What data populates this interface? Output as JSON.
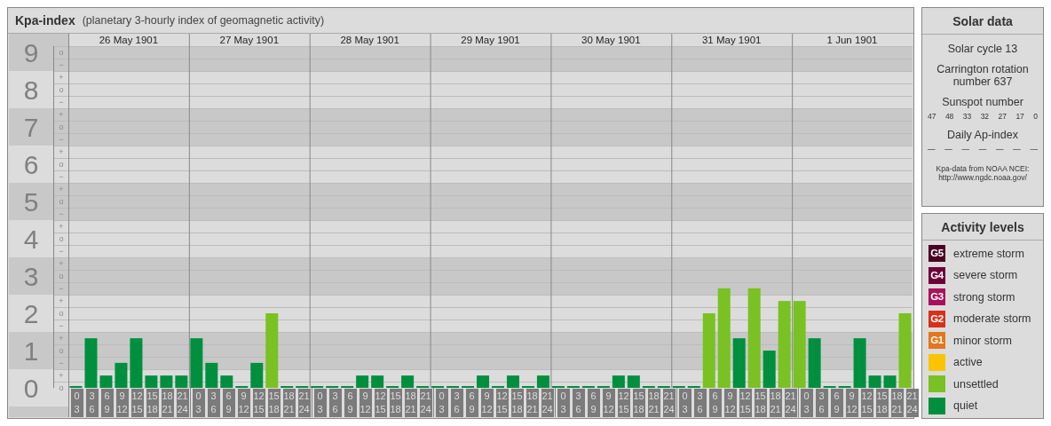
{
  "kpa_panel": {
    "title": "Kpa-index",
    "subtitle": "(planetary 3-hourly index of geomagnetic activity)",
    "days": [
      "26 May 1901",
      "27 May 1901",
      "28 May 1901",
      "29 May 1901",
      "30 May 1901",
      "31 May 1901",
      "1 Jun 1901"
    ],
    "chart_data": {
      "type": "bar",
      "ylim": [
        0,
        9.5
      ],
      "grid": true,
      "categories": [
        "0 3",
        "3 6",
        "6 9",
        "9 12",
        "12 15",
        "15 18",
        "18 21",
        "21 24",
        "0 3",
        "3 6",
        "6 9",
        "9 12",
        "12 15",
        "15 18",
        "18 21",
        "21 24",
        "0 3",
        "3 6",
        "6 9",
        "9 12",
        "12 15",
        "15 18",
        "18 21",
        "21 24",
        "0 3",
        "3 6",
        "6 9",
        "9 12",
        "12 15",
        "15 18",
        "18 21",
        "21 24",
        "0 3",
        "3 6",
        "6 9",
        "9 12",
        "12 15",
        "15 18",
        "18 21",
        "21 24",
        "0 3",
        "3 6",
        "6 9",
        "9 12",
        "12 15",
        "15 18",
        "18 21",
        "21 24",
        "0 3",
        "3 6",
        "6 9",
        "9 12",
        "12 15",
        "15 18",
        "18 21",
        "21 24"
      ],
      "series": [
        {
          "color": "#008f3e",
          "values": [
            0,
            1.33,
            0.33,
            0.67,
            1.33,
            0.33,
            0.33,
            0.33,
            1.33,
            0.67,
            0.33,
            0,
            0.67,
            null,
            0,
            0,
            0,
            0,
            0,
            0.33,
            0.33,
            0,
            0.33,
            0,
            0,
            0,
            0,
            0.33,
            0,
            0.33,
            0,
            0.33,
            0,
            0,
            0,
            0,
            0.33,
            0.33,
            0,
            0,
            0,
            0,
            null,
            null,
            1.33,
            null,
            1,
            null,
            null,
            1.33,
            0,
            0,
            1.33,
            0.33,
            0.33,
            null
          ]
        },
        {
          "color": "#7ac123",
          "values": [
            null,
            null,
            null,
            null,
            null,
            null,
            null,
            null,
            null,
            null,
            null,
            null,
            null,
            2,
            null,
            null,
            null,
            null,
            null,
            null,
            null,
            null,
            null,
            null,
            null,
            null,
            null,
            null,
            null,
            null,
            null,
            null,
            null,
            null,
            null,
            null,
            null,
            null,
            null,
            null,
            null,
            null,
            2,
            2.67,
            null,
            2.67,
            null,
            2.33,
            2.33,
            null,
            null,
            null,
            null,
            null,
            null,
            2
          ]
        }
      ],
      "yticks": [
        0,
        1,
        2,
        3,
        4,
        5,
        6,
        7,
        8,
        9
      ],
      "annotations": [
        "o",
        "+",
        "−",
        "o",
        "+",
        "−",
        "o",
        "+",
        "−",
        "o",
        "+",
        "−",
        "o",
        "+",
        "−",
        "o",
        "+",
        "−",
        "o",
        "+",
        "−",
        "o",
        "+",
        "−",
        "o",
        "+",
        "−",
        "o"
      ]
    }
  },
  "solar_data": {
    "title": "Solar data",
    "solar_cycle": "Solar cycle 13",
    "carrington": "Carrington rotation number 637",
    "sunspot_heading": "Sunspot number",
    "sunspot_numbers": [
      "47",
      "48",
      "33",
      "32",
      "27",
      "17",
      "0"
    ],
    "ap_heading": "Daily Ap-index",
    "ap_values": [
      "—",
      "—",
      "—",
      "—",
      "—",
      "—",
      "—"
    ],
    "source": "Kpa-data from NOAA NCEI:\nhttp://www.ngdc.noaa.gov/"
  },
  "activity_levels": {
    "title": "Activity levels",
    "items": [
      {
        "badge": "G5",
        "label": "extreme storm",
        "color": "#4a0022"
      },
      {
        "badge": "G4",
        "label": "severe storm",
        "color": "#6e0038"
      },
      {
        "badge": "G3",
        "label": "strong storm",
        "color": "#a8125c"
      },
      {
        "badge": "G2",
        "label": "moderate storm",
        "color": "#d9301c"
      },
      {
        "badge": "G1",
        "label": "minor storm",
        "color": "#e5761b"
      },
      {
        "label": "active",
        "color": "#fac400"
      },
      {
        "label": "unsettled",
        "color": "#7ac123"
      },
      {
        "label": "quiet",
        "color": "#008f3e"
      }
    ]
  }
}
